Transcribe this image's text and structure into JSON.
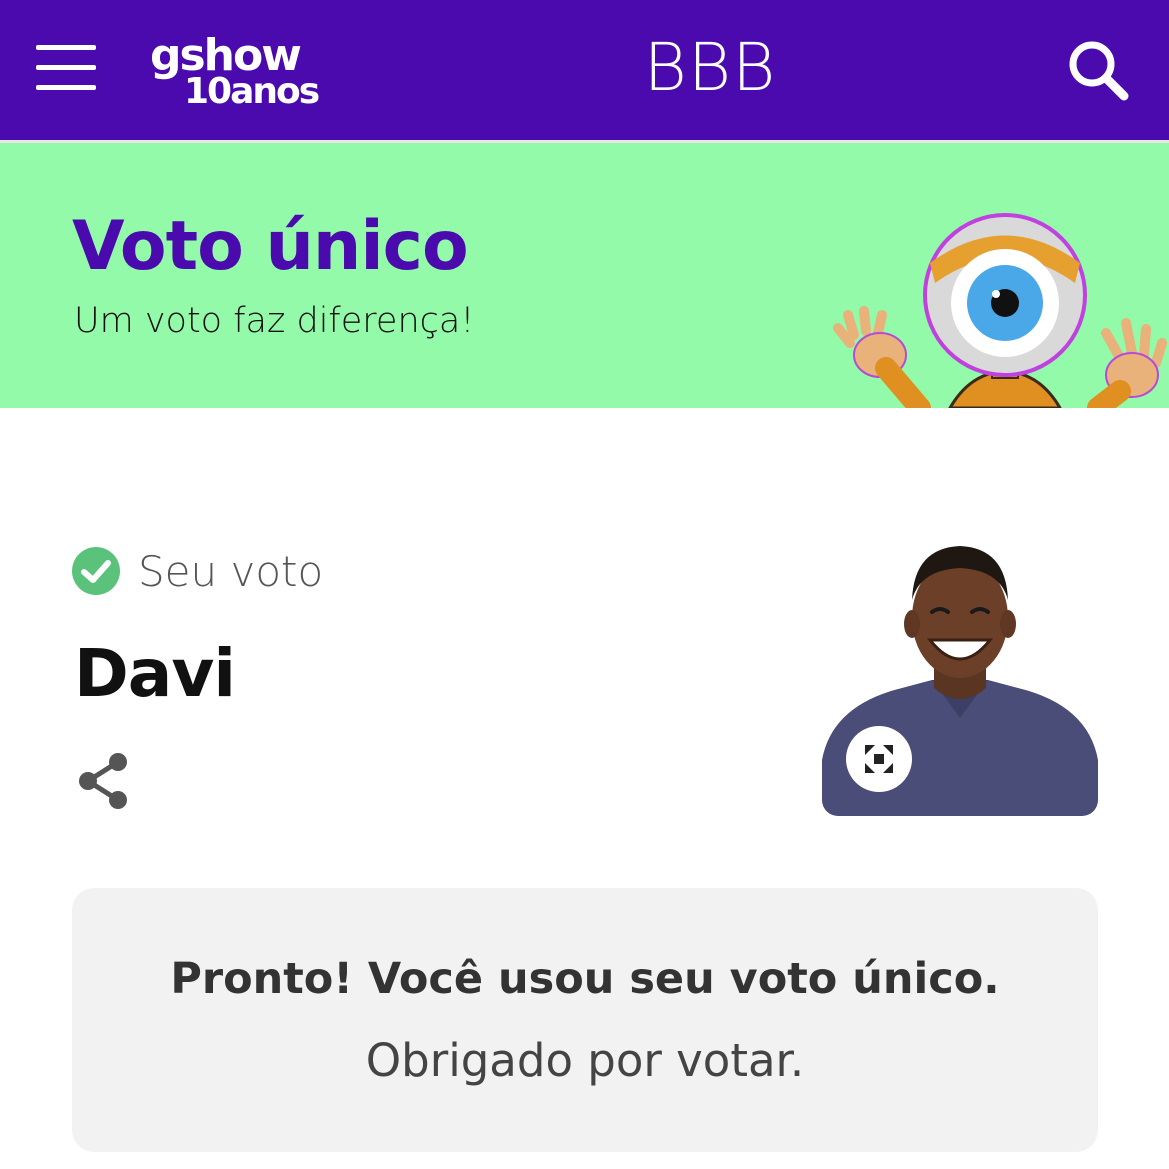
{
  "colors": {
    "header_bg": "#4a0aad",
    "banner_bg": "#93faaa",
    "accent_purple": "#4a0aad",
    "check_green": "#5ac27a",
    "card_bg": "#f2f2f2"
  },
  "header": {
    "logo_text": "gshow",
    "logo_subtext": "10anos",
    "title": "BBB",
    "menu_icon": "hamburger-menu-icon",
    "search_icon": "search-icon"
  },
  "banner": {
    "title": "Voto único",
    "subtitle": "Um voto faz diferença!",
    "mascot": "bbb-eye-mascot"
  },
  "vote": {
    "status_label": "Seu voto",
    "status_icon": "check-circle-icon",
    "candidate_name": "Davi",
    "share_icon": "share-icon",
    "expand_icon": "expand-icon"
  },
  "confirmation": {
    "title": "Pronto! Você usou seu voto único.",
    "message": "Obrigado por votar."
  }
}
